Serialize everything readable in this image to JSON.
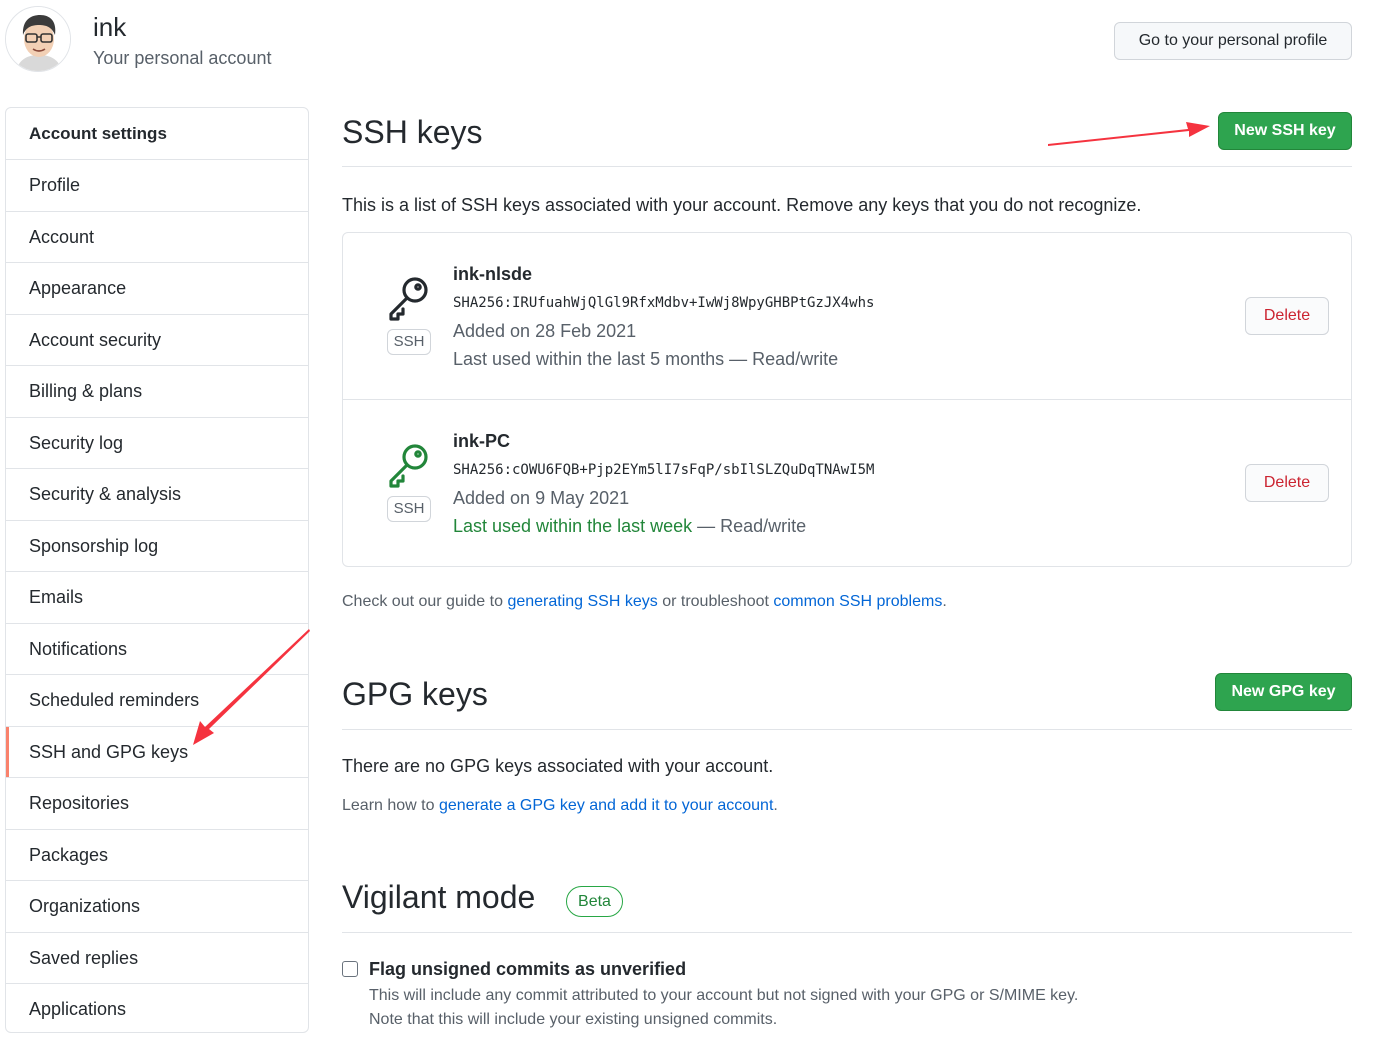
{
  "header": {
    "username": "ink",
    "subtitle": "Your personal account",
    "profile_button": "Go to your personal profile"
  },
  "sidebar": {
    "heading": "Account settings",
    "items": [
      {
        "label": "Profile"
      },
      {
        "label": "Account"
      },
      {
        "label": "Appearance"
      },
      {
        "label": "Account security"
      },
      {
        "label": "Billing & plans"
      },
      {
        "label": "Security log"
      },
      {
        "label": "Security & analysis"
      },
      {
        "label": "Sponsorship log"
      },
      {
        "label": "Emails"
      },
      {
        "label": "Notifications"
      },
      {
        "label": "Scheduled reminders"
      },
      {
        "label": "SSH and GPG keys",
        "selected": true
      },
      {
        "label": "Repositories"
      },
      {
        "label": "Packages"
      },
      {
        "label": "Organizations"
      },
      {
        "label": "Saved replies"
      },
      {
        "label": "Applications"
      }
    ]
  },
  "ssh": {
    "title": "SSH keys",
    "new_button": "New SSH key",
    "description": "This is a list of SSH keys associated with your account. Remove any keys that you do not recognize.",
    "keys": [
      {
        "name": "ink-nlsde",
        "type_label": "SSH",
        "fingerprint": "SHA256:IRUfuahWjQlGl9RfxMdbv+IwWj8WpyGHBPtGzJX4whs",
        "added": "Added on 28 Feb 2021",
        "last_used": "Last used within the last 5 months",
        "access": " — Read/write",
        "recent": false,
        "icon_color": "#24292e",
        "delete_label": "Delete"
      },
      {
        "name": "ink-PC",
        "type_label": "SSH",
        "fingerprint": "SHA256:cOWU6FQB+Pjp2EYm5lI7sFqP/sbIlSLZQuDqTNAwI5M",
        "added": "Added on 9 May 2021",
        "last_used": "Last used within the last week",
        "access": " — Read/write",
        "recent": true,
        "icon_color": "#22863a",
        "delete_label": "Delete"
      }
    ],
    "guide_prefix": "Check out our guide to ",
    "guide_link1": "generating SSH keys",
    "guide_middle": " or troubleshoot ",
    "guide_link2": "common SSH problems",
    "guide_suffix": "."
  },
  "gpg": {
    "title": "GPG keys",
    "new_button": "New GPG key",
    "empty_text": "There are no GPG keys associated with your account.",
    "learn_prefix": "Learn how to ",
    "learn_link": "generate a GPG key and add it to your account",
    "learn_suffix": "."
  },
  "vigilant": {
    "title": "Vigilant mode",
    "badge": "Beta",
    "checkbox_label": "Flag unsigned commits as unverified",
    "checked": false,
    "note_line1": "This will include any commit attributed to your account but not signed with your GPG or S/MIME key.",
    "note_line2": "Note that this will include your existing unsigned commits."
  },
  "colors": {
    "primary_green": "#2ea44f",
    "link_blue": "#0366d6",
    "danger_red": "#cb2431",
    "selected_marker": "#f9826c",
    "annotation_arrow": "#f5333f"
  }
}
